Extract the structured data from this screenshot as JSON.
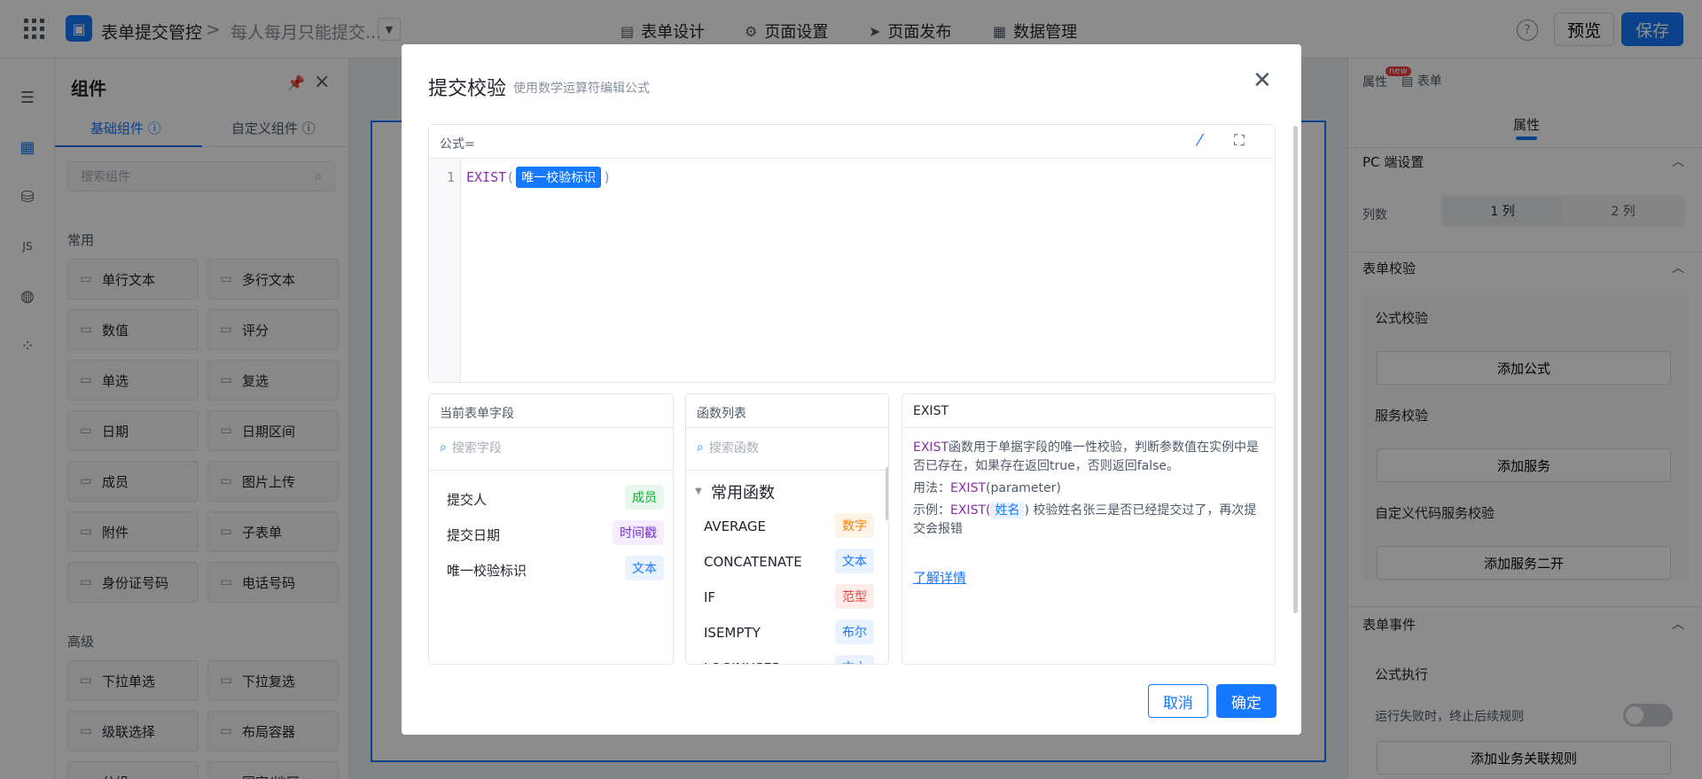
{
  "topbar": {
    "app_name": "表单提交管控",
    "separator": ">",
    "form_name": "每人每月只能提交...",
    "tabs": [
      {
        "icon": "document-icon",
        "label": "表单设计"
      },
      {
        "icon": "gear-icon",
        "label": "页面设置"
      },
      {
        "icon": "send-icon",
        "label": "页面发布"
      },
      {
        "icon": "table-icon",
        "label": "数据管理"
      }
    ],
    "help": "?",
    "preview_label": "预览",
    "save_label": "保存"
  },
  "components": {
    "title": "组件",
    "tabs": [
      {
        "label": "基础组件",
        "active": true
      },
      {
        "label": "自定义组件",
        "active": false
      }
    ],
    "search_placeholder": "搜索组件",
    "groups": [
      {
        "title": "常用",
        "items": [
          {
            "label": "单行文本",
            "icon": "text-icon"
          },
          {
            "label": "多行文本",
            "icon": "textarea-icon"
          },
          {
            "label": "数值",
            "icon": "number-icon"
          },
          {
            "label": "评分",
            "icon": "star-icon"
          },
          {
            "label": "单选",
            "icon": "radio-icon"
          },
          {
            "label": "复选",
            "icon": "checkbox-icon"
          },
          {
            "label": "日期",
            "icon": "calendar-icon"
          },
          {
            "label": "日期区间",
            "icon": "calendar-range-icon"
          },
          {
            "label": "成员",
            "icon": "user-icon"
          },
          {
            "label": "图片上传",
            "icon": "image-icon"
          },
          {
            "label": "附件",
            "icon": "paperclip-icon"
          },
          {
            "label": "子表单",
            "icon": "subform-icon"
          },
          {
            "label": "身份证号码",
            "icon": "id-card-icon"
          },
          {
            "label": "电话号码",
            "icon": "phone-icon"
          }
        ]
      },
      {
        "title": "高级",
        "items": [
          {
            "label": "下拉单选",
            "icon": "select-icon"
          },
          {
            "label": "下拉复选",
            "icon": "multi-select-icon"
          },
          {
            "label": "级联选择",
            "icon": "cascader-icon"
          },
          {
            "label": "布局容器",
            "icon": "layout-icon"
          },
          {
            "label": "分组",
            "icon": "group-icon"
          },
          {
            "label": "国家/地区",
            "icon": "globe-icon"
          }
        ]
      }
    ]
  },
  "right_panel": {
    "tab_new_badge": "new",
    "tab_props": "属性",
    "tab_form": "表单",
    "sub_tab": "属性",
    "pc_settings": "PC 端设置",
    "columns_label": "列数",
    "column_options": [
      "1 列",
      "2 列"
    ],
    "form_validation": "表单校验",
    "formula_validation": "公式校验",
    "add_formula": "添加公式",
    "service_validation": "服务校验",
    "add_service": "添加服务",
    "custom_code_validation": "自定义代码服务校验",
    "add_service_dev": "添加服务二开",
    "form_events": "表单事件",
    "formula_exec": "公式执行",
    "stop_on_fail": "运行失败时，终止后续规则",
    "add_rule": "添加业务关联规则"
  },
  "modal": {
    "title": "提交校验",
    "subtitle": "使用数学运算符编辑公式",
    "formula_label": "公式=",
    "line_number": "1",
    "code_fn": "EXIST",
    "code_open": "(",
    "code_field": "唯一校验标识",
    "code_close": ")",
    "fields": {
      "title": "当前表单字段",
      "search_placeholder": "搜索字段",
      "items": [
        {
          "name": "提交人",
          "type": "成员",
          "color": "green"
        },
        {
          "name": "提交日期",
          "type": "时间戳",
          "color": "purple"
        },
        {
          "name": "唯一校验标识",
          "type": "文本",
          "color": "blue"
        }
      ]
    },
    "functions": {
      "title": "函数列表",
      "search_placeholder": "搜索函数",
      "group": "常用函数",
      "items": [
        {
          "name": "AVERAGE",
          "type": "数字",
          "color": "orange"
        },
        {
          "name": "CONCATENATE",
          "type": "文本",
          "color": "blue"
        },
        {
          "name": "IF",
          "type": "范型",
          "color": "red"
        },
        {
          "name": "ISEMPTY",
          "type": "布尔",
          "color": "blue"
        },
        {
          "name": "LOGINUSER",
          "type": "文本",
          "color": "blue"
        }
      ]
    },
    "doc": {
      "title": "EXIST",
      "desc_fn": "EXIST",
      "desc_rest": "函数用于单据字段的唯一性校验，判断参数值在实例中是否已存在，如果存在返回true，否则返回false。",
      "usage_label": "用法：",
      "usage_fn": "EXIST",
      "usage_args": "(parameter)",
      "example_label": "示例：",
      "example_fn": "EXIST(",
      "example_chip": "姓名",
      "example_rest": ") 校验姓名张三是否已经提交过了，再次提交会报错",
      "link": "了解详情"
    },
    "cancel_label": "取消",
    "ok_label": "确定"
  }
}
